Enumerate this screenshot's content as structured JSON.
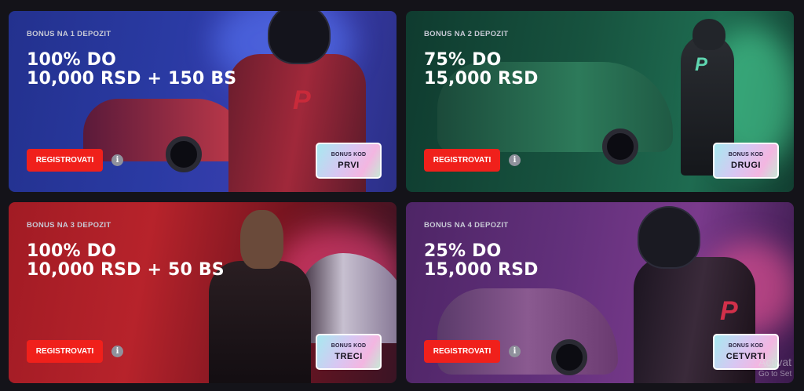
{
  "cards": [
    {
      "label": "BONUS NA 1 DEPOZIT",
      "headline_line1": "100% DO",
      "headline_line2": "10,000 RSD + 150 BS",
      "button": "REGISTROVATI",
      "info_icon": "info-icon",
      "code_title": "BONUS KOD",
      "code_value": "PRVI"
    },
    {
      "label": "BONUS NA 2 DEPOZIT",
      "headline_line1": "75% DO",
      "headline_line2": "15,000 RSD",
      "button": "REGISTROVATI",
      "info_icon": "info-icon",
      "code_title": "BONUS KOD",
      "code_value": "DRUGI"
    },
    {
      "label": "BONUS NA 3 DEPOZIT",
      "headline_line1": "100% DO",
      "headline_line2": "10,000 RSD + 50 BS",
      "button": "REGISTROVATI",
      "info_icon": "info-icon",
      "code_title": "BONUS KOD",
      "code_value": "TRECI"
    },
    {
      "label": "BONUS NA 4 DEPOZIT",
      "headline_line1": "25% DO",
      "headline_line2": "15,000 RSD",
      "button": "REGISTROVATI",
      "info_icon": "info-icon",
      "code_title": "BONUS KOD",
      "code_value": "CETVRTI"
    }
  ],
  "watermark": {
    "line1": "Activat",
    "line2": "Go to Set"
  },
  "colors": {
    "button": "#f0201b",
    "page_bg": "#141319"
  }
}
